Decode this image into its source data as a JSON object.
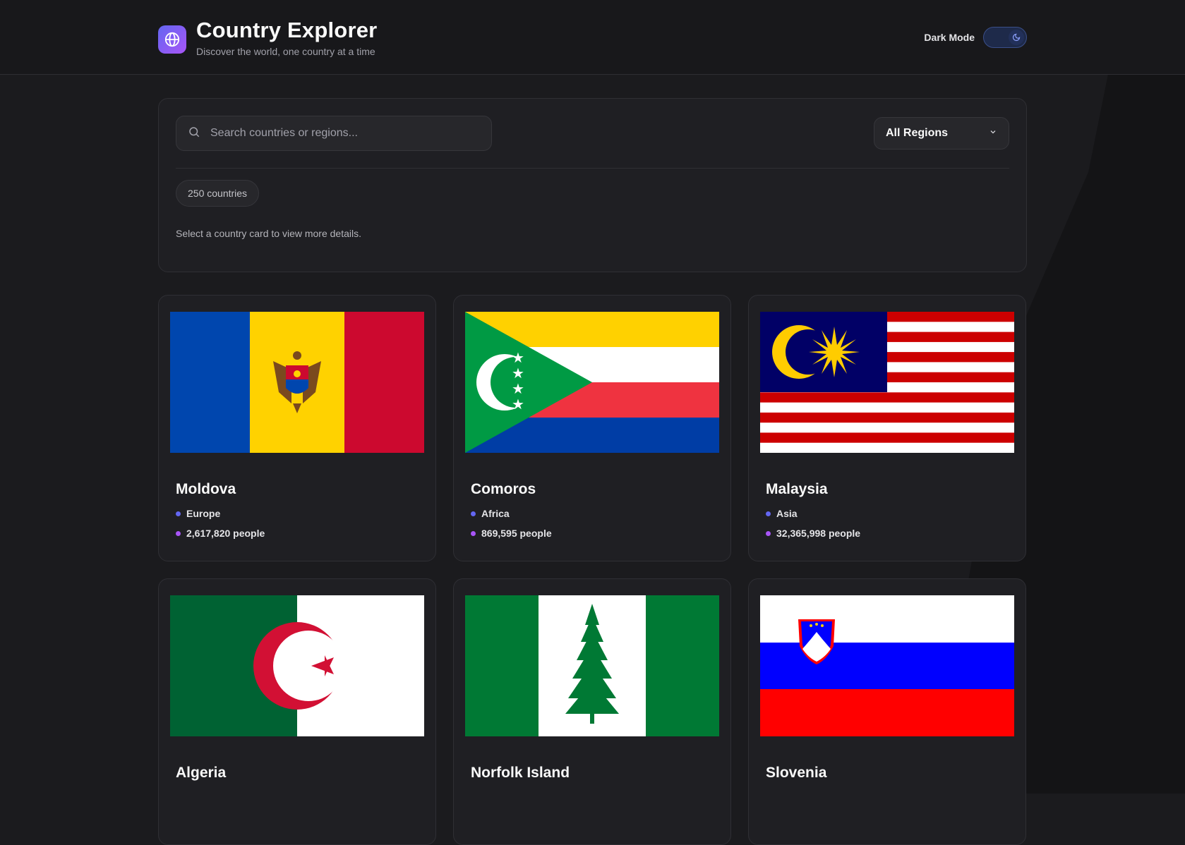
{
  "header": {
    "title": "Country Explorer",
    "subtitle": "Discover the world, one country at a time",
    "mode_label": "Dark Mode"
  },
  "search": {
    "placeholder": "Search countries or regions...",
    "value": ""
  },
  "filter": {
    "selected": "All Regions"
  },
  "count_label": "250 countries",
  "hint": "Select a country card to view more details.",
  "countries": [
    {
      "name": "Moldova",
      "region": "Europe",
      "population": "2,617,820 people"
    },
    {
      "name": "Comoros",
      "region": "Africa",
      "population": "869,595 people"
    },
    {
      "name": "Malaysia",
      "region": "Asia",
      "population": "32,365,998 people"
    },
    {
      "name": "Algeria"
    },
    {
      "name": "Norfolk Island"
    },
    {
      "name": "Slovenia"
    }
  ],
  "colors": {
    "accent": "#6366f1",
    "accent2": "#a855f7",
    "background": "#1b1b1e",
    "surface": "#1f1f23"
  },
  "icons": {
    "logo": "globe-icon",
    "search": "search-icon",
    "select": "chevron-down-icon",
    "toggle": "moon-icon"
  }
}
